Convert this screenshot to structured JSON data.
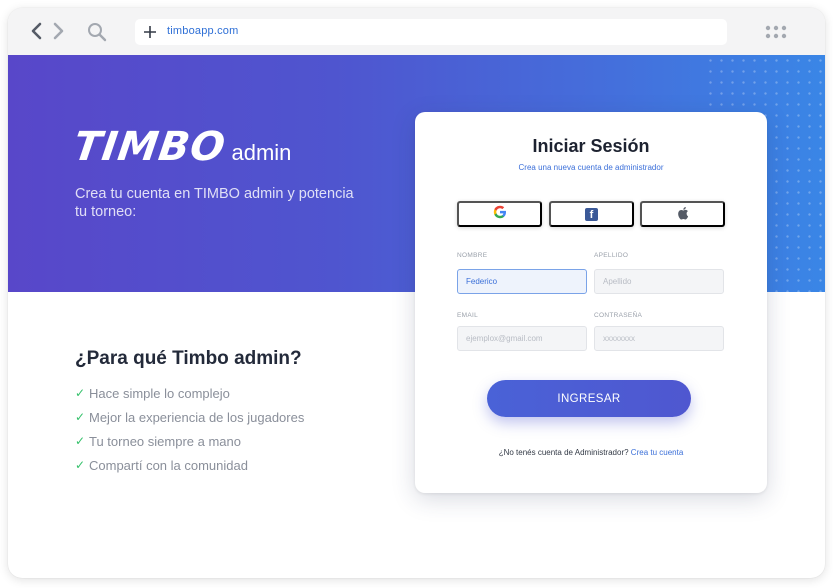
{
  "browser": {
    "url": "timboapp.com",
    "icons": {
      "back": "chevron-left-icon",
      "forward": "chevron-right-icon",
      "search": "search-icon",
      "new_tab": "plus-icon",
      "menu": "grid-dots-icon"
    }
  },
  "hero": {
    "logo_word": "TIMBO",
    "logo_suffix": "admin",
    "tagline": "Crea tu cuenta en TIMBO admin y potencia tu torneo:",
    "gradient_colors": [
      "#5847c9",
      "#3a86e6"
    ]
  },
  "why": {
    "title": "¿Para qué Timbo admin?",
    "items": [
      "Hace simple lo complejo",
      "Mejor la experiencia de los jugadores",
      "Tu torneo siempre a mano",
      "Compartí con la comunidad"
    ]
  },
  "login": {
    "title": "Iniciar Sesión",
    "subtitle": "Crea una nueva cuenta de administrador",
    "social": [
      "google-icon",
      "facebook-icon",
      "apple-icon"
    ],
    "fields": {
      "nombre_label": "NOMBRE",
      "nombre_value": "Federico",
      "apellido_label": "APELLIDO",
      "apellido_placeholder": "Apellido",
      "email_label": "EMAIL",
      "email_placeholder": "ejemplox@gmail.com",
      "contrasena_label": "CONTRASEÑA",
      "contrasena_placeholder": "xxxxxxxx"
    },
    "submit_label": "INGRESAR",
    "no_account_text": "¿No tenés cuenta de Administrador?",
    "create_link": "Crea tu cuenta"
  },
  "colors": {
    "accent": "#3a6fd8",
    "check": "#35c16b",
    "button": "#4a62d7"
  }
}
